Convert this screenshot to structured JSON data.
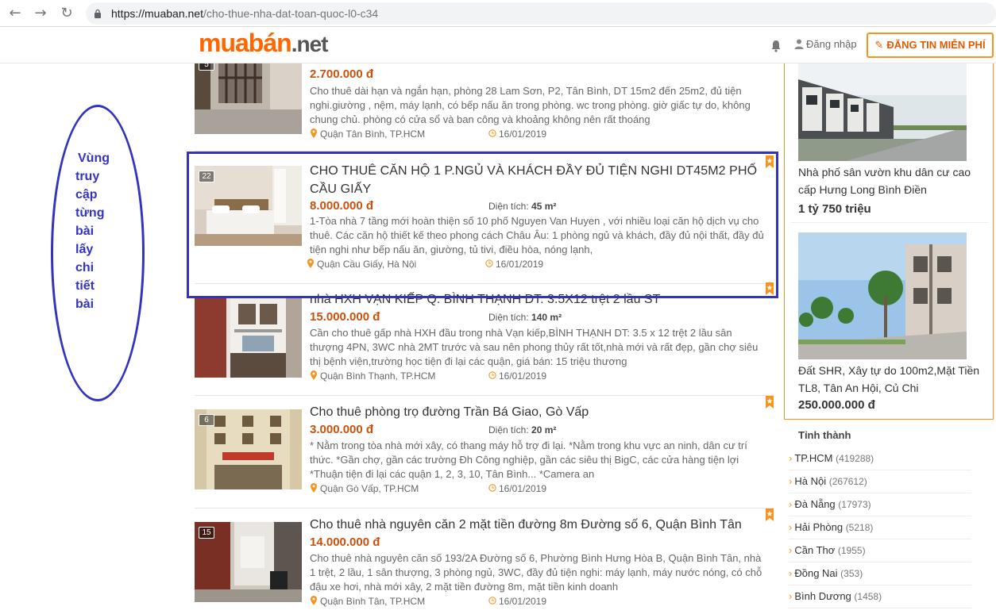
{
  "browser": {
    "url_host": "https://muaban.net",
    "url_path": "/cho-thue-nha-dat-toan-quoc-l0-c34"
  },
  "header": {
    "logo_main": "muabán",
    "logo_suffix": ".net",
    "login_label": "Đăng nhập",
    "post_button_label": "ĐĂNG TIN MIỄN PHÍ"
  },
  "annotation": {
    "lines": [
      "Vùng",
      "truy",
      "cập",
      "từng",
      "bài",
      "lấy",
      "chi",
      "tiết",
      "bài"
    ],
    "color": "#3333bb"
  },
  "listings": [
    {
      "photo_count": "5",
      "title": "",
      "price": "2.700.000 đ",
      "area_label": "",
      "area_value": "",
      "description": "Cho thuê dài hạn và ngắn hạn, phòng 28 Lam Sơn, P2, Tân Bình, DT 15m2 đến 25m2, đủ tiện nghi.giường , nệm, máy lạnh, có bếp nấu ăn trong phòng. wc trong phòng. giờ giấc tự do, không chung chủ. phòng có cửa sổ và ban công và khoảng không nên rất thoáng",
      "location": "Quận Tân Bình, TP.HCM",
      "date": "16/01/2019"
    },
    {
      "photo_count": "22",
      "title": "CHO THUÊ CĂN HỘ 1 P.NGỦ VÀ KHÁCH ĐẦY ĐỦ TIỆN NGHI DT45M2 PHỐ CẦU GIẤY",
      "price": "8.000.000 đ",
      "area_label": "Diện tích:",
      "area_value": "45 m²",
      "description": "1-Tòa nhà 7 tầng mới hoàn thiện số 10 phố Nguyen Van Huyen , với nhiều loại căn hộ dịch vụ cho thuê. Các căn hộ thiết kế theo phong cách Châu Âu: 1 phòng ngủ và khách, đầy đủ nội thất, đầy đủ tiện nghi như bếp nấu ăn, giường, tủ tivi, điều hòa, nóng lạnh,",
      "location": "Quận Cầu Giấy, Hà Nội",
      "date": "16/01/2019"
    },
    {
      "photo_count": "",
      "title": "nhà HXH VẠN KIẾP Q. BÌNH THẠNH DT: 3.5X12 trệt 2 lầu ST",
      "price": "15.000.000 đ",
      "area_label": "Diện tích:",
      "area_value": "140 m²",
      "description": "Cần cho thuê gấp nhà HXH đầu trong nhà Vạn kiếp,BÌNH THẠNH DT: 3.5 x 12 trệt 2 lầu sân thượng 4PN, 3WC nhà 2MT trước và sau nên phong thủy rất tốt,nhà mới và rất đẹp, gần chợ siêu thị bệnh viện,trường học tiện đi lại các quận, giá bán: 15 triệu thương",
      "location": "Quận Bình Thạnh, TP.HCM",
      "date": "16/01/2019"
    },
    {
      "photo_count": "6",
      "title": "Cho thuê phòng trọ đường Trần Bá Giao, Gò Vấp",
      "price": "3.000.000 đ",
      "area_label": "Diện tích:",
      "area_value": "20 m²",
      "description": "* Nằm trong tòa nhà mới xây, có thang máy hỗ trợ đi lại. *Nằm trong khu vực an ninh, dân cư trí thức. *Gần chợ, gần các trường Đh Công nghiệp, gần các siêu thị BigC, các cửa hàng tiện lợi *Thuận tiện đi lại các quận 1, 2, 3, 10, Tân Bình... *Camera an",
      "location": "Quận Gò Vấp, TP.HCM",
      "date": "16/01/2019"
    },
    {
      "photo_count": "15",
      "title": "Cho thuê nhà nguyên căn 2 mặt tiền đường 8m Đường số 6, Quận Bình Tân",
      "price": "14.000.000 đ",
      "area_label": "",
      "area_value": "",
      "description": "Cho thuê nhà nguyên căn số 193/2A Đường số 6, Phường Bình Hưng Hòa B, Quận Bình Tân, nhà 1 trệt, 2 lầu, 1 sân thượng, 3 phòng ngủ, 3WC, đầy đủ tiện nghi: máy lạnh, máy nước nóng, có chỗ đậu xe hơi, nhà mới xây, 2 mặt tiền đường 8m, mặt tiền kinh doanh",
      "location": "Quận Bình Tân, TP.HCM",
      "date": "16/01/2019"
    }
  ],
  "ads": [
    {
      "title": "Nhà phố sân vườn khu dân cư cao cấp Hưng Long Bình Điền",
      "price": "1 tỷ 750 triệu"
    },
    {
      "title": "Đất SHR, Xây tự do 100m2,Mặt Tiền TL8, Tân An Hội, Củ Chi",
      "price": "250.000.000 đ"
    }
  ],
  "provinces": {
    "heading": "Tỉnh thành",
    "items": [
      {
        "name": "TP.HCM",
        "count": "(419288)"
      },
      {
        "name": "Hà Nội",
        "count": "(267612)"
      },
      {
        "name": "Đà Nẵng",
        "count": "(17973)"
      },
      {
        "name": "Hải Phòng",
        "count": "(5218)"
      },
      {
        "name": "Cần Thơ",
        "count": "(1955)"
      },
      {
        "name": "Đồng Nai",
        "count": "(353)"
      },
      {
        "name": "Bình Dương",
        "count": "(1458)"
      }
    ]
  },
  "colors": {
    "brand_orange": "#ff6600",
    "price_orange": "#c9510c",
    "highlight_blue": "#3333bb"
  }
}
